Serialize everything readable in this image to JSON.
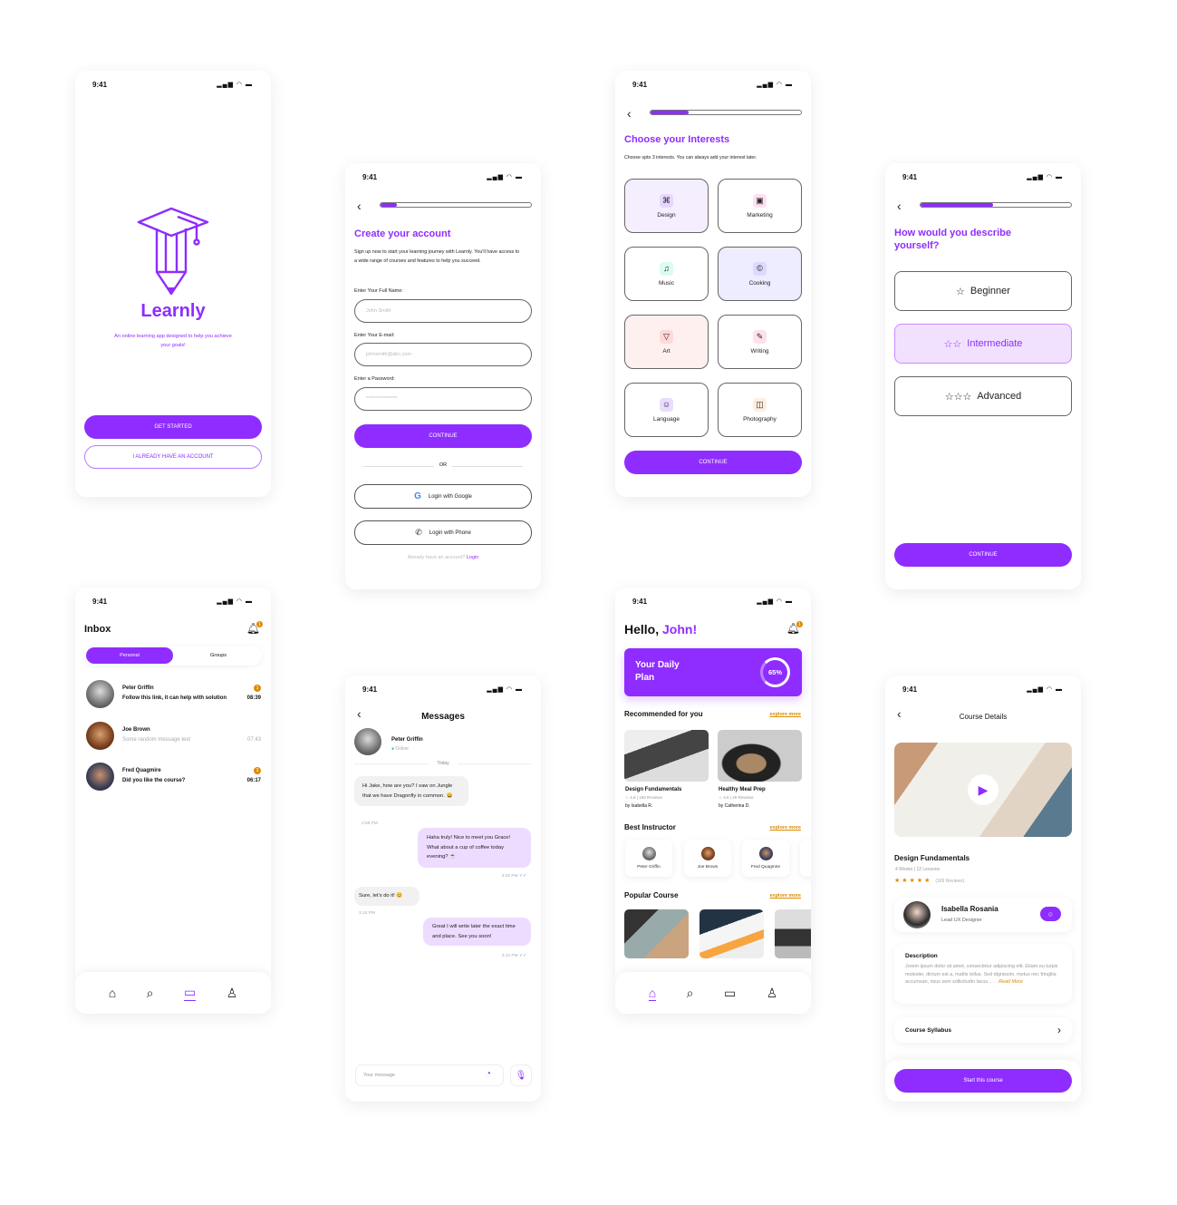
{
  "colors": {
    "accent": "#8f2cff",
    "badge": "#e08a00",
    "explore": "#d98a00"
  },
  "status": {
    "time": "9:41",
    "icons": "signal wifi battery"
  },
  "welcome": {
    "brand": "Learnly",
    "tagline": "An online learning app designed to help you achieve your goals!",
    "get_started": "GET STARTED",
    "have_account": "I ALREADY HAVE AN ACCOUNT",
    "logo_icon": "graduation-pencil-icon"
  },
  "signup": {
    "progress": 0.1,
    "title": "Create your account",
    "description": "Sign up now to start your learning journey with Learnly. You'll have access to a wide range of courses and features to help you succeed.",
    "name_label": "Enter Your Full Name:",
    "name_placeholder": "John Smith",
    "email_label": "Enter Your E-mail:",
    "email_placeholder": "johnsmith@abc.com",
    "password_label": "Enter a Password:",
    "password_placeholder": "****************",
    "continue": "CONTINUE",
    "or": "OR",
    "google": "Login with Google",
    "phone": "Login with Phone",
    "already": "Already have an account?",
    "login": "Login"
  },
  "interests": {
    "progress": 0.25,
    "title": "Choose your Interests",
    "description": "Choose upto 3 interests. You can always add your interest later.",
    "items": [
      {
        "label": "Design",
        "selected": true
      },
      {
        "label": "Marketing",
        "selected": false
      },
      {
        "label": "Music",
        "selected": false
      },
      {
        "label": "Cooking",
        "selected": true
      },
      {
        "label": "Art",
        "selected": true
      },
      {
        "label": "Writing",
        "selected": false
      },
      {
        "label": "Language",
        "selected": false
      },
      {
        "label": "Photography",
        "selected": false
      }
    ],
    "continue": "CONTINUE"
  },
  "level": {
    "progress": 0.48,
    "title": "How would you describe yourself?",
    "options": [
      {
        "label": "Beginner",
        "stars": 1
      },
      {
        "label": "Intermediate",
        "stars": 2,
        "selected": true
      },
      {
        "label": "Advanced",
        "stars": 3
      }
    ],
    "continue": "CONTINUE"
  },
  "inbox": {
    "title": "Inbox",
    "notification_count": "1",
    "tabs": [
      "Personal",
      "Groups"
    ],
    "active_tab": "Personal",
    "rows": [
      {
        "name": "Peter Griffin",
        "message": "Follow this link, it can help with solution",
        "time": "08:39",
        "unread": "1"
      },
      {
        "name": "Joe Brown",
        "message": "Some random message text",
        "time": "07:43"
      },
      {
        "name": "Fred Quagmire",
        "message": "Did you like the course?",
        "time": "06:17",
        "unread": "3"
      }
    ]
  },
  "messages": {
    "title": "Messages",
    "contact": "Peter Griffin",
    "presence": "Online",
    "day": "Today",
    "items": [
      {
        "text": "Hi Jake, how are you? I saw on Jungle that we have Dragonfly in common. 😄",
        "time": "2:55 PM",
        "dir": "in"
      },
      {
        "text": "Haha truly! Nice to meet you Grace! What about a cup of coffee today evening? ☕",
        "time": "3:02 PM",
        "dir": "out"
      },
      {
        "text": "Sure, let's do it! 😊",
        "time": "3:10 PM",
        "dir": "in"
      },
      {
        "text": "Great I will write later the exact time and place. See you soon!",
        "time": "3:12 PM",
        "dir": "out"
      }
    ],
    "placeholder": "Your message"
  },
  "home": {
    "greeting": "Hello,",
    "name": "John!",
    "notification_count": "1",
    "plan_title": "Your Daily Plan",
    "plan_progress": "65%",
    "recommended": "Recommended for you",
    "explore": "explore more",
    "courses": [
      {
        "title": "Design Fundamentals",
        "rating": "4.8 | 169 Reviews",
        "author": "by Isabella R."
      },
      {
        "title": "Healthy Meal Prep",
        "rating": "4.6 | 49 Reviews",
        "author": "by Catherina D."
      }
    ],
    "best_instructor": "Best Instructor",
    "instructors": [
      "Peter Griffin",
      "Joe Brown",
      "Fred Quagmire"
    ],
    "popular": "Popular Course"
  },
  "course": {
    "header": "Course Details",
    "title": "Design Fundamentals",
    "meta": "4 Weeks | 12 Lessons",
    "rating": 5,
    "reviews": "(169 Reviews)",
    "instructor": "Isabella Rosania",
    "role": "Lead UX Designer",
    "desc_title": "Description",
    "desc": "Jorem ipsum dolor sit amet, consectetur adipiscing elit. Etiam eu turpis molestie, dictum est a, mattis tellus. Sed dignissim, metus nec fringilla accumsan, risus sem sollicitudin lacus. . . .",
    "read_more": "Read More",
    "syllabus": "Course Syllabus",
    "start": "Start this course"
  }
}
